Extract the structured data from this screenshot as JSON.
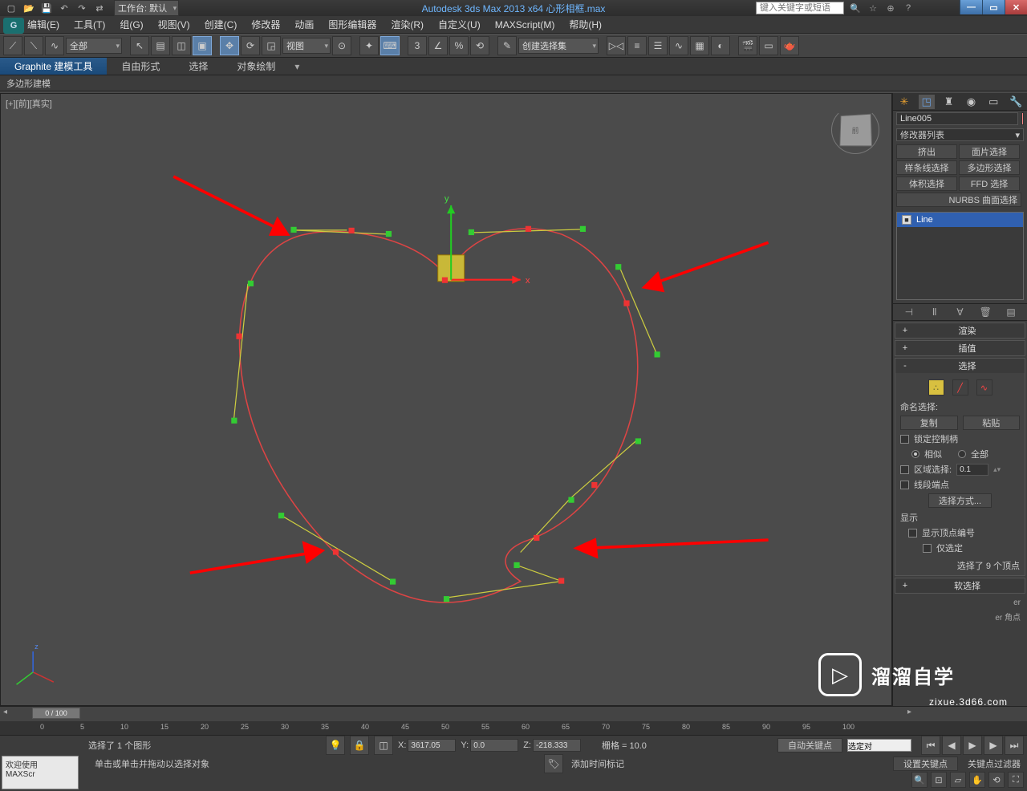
{
  "titlebar": {
    "workspace_label": "工作台: 默认",
    "title": "Autodesk 3ds Max  2013 x64    心形相框.max",
    "search_placeholder": "键入关键字或短语"
  },
  "menu": {
    "items": [
      "编辑(E)",
      "工具(T)",
      "组(G)",
      "视图(V)",
      "创建(C)",
      "修改器",
      "动画",
      "图形编辑器",
      "渲染(R)",
      "自定义(U)",
      "MAXScript(M)",
      "帮助(H)"
    ]
  },
  "toolbar": {
    "sel_filter": "全部",
    "view_dd": "视图",
    "named_set": "创建选择集"
  },
  "ribbon": {
    "tabs": [
      "Graphite 建模工具",
      "自由形式",
      "选择",
      "对象绘制"
    ],
    "sublabel": "多边形建模"
  },
  "viewport": {
    "label": "[+][前][真实]",
    "cube_face": "前",
    "axis": {
      "x": "x",
      "y": "y",
      "z": "z"
    }
  },
  "panel": {
    "obj_name": "Line005",
    "mod_list_label": "修改器列表",
    "quick_buttons": [
      "挤出",
      "面片选择",
      "样条线选择",
      "多边形选择",
      "体积选择",
      "FFD 选择"
    ],
    "nurbs_label": "NURBS 曲面选择",
    "stack_item": "Line",
    "rollouts": {
      "render": "渲染",
      "interp": "插值",
      "select": "选择",
      "soft": "软选择"
    },
    "select_body": {
      "named_label": "命名选择:",
      "copy": "复制",
      "paste": "粘贴",
      "lock_handles": "锁定控制柄",
      "similar": "相似",
      "all": "全部",
      "area_sel": "区域选择:",
      "area_val": "0.1",
      "seg_end": "线段端点",
      "sel_mode": "选择方式...",
      "display": "显示",
      "show_vnum": "显示顶点编号",
      "only_sel": "仅选定",
      "count": "选择了 9 个顶点"
    },
    "ext1": "er",
    "ext2": "er 角点"
  },
  "timeline": {
    "frame_label": "0 / 100",
    "ticks": [
      "0",
      "5",
      "10",
      "15",
      "20",
      "25",
      "30",
      "35",
      "40",
      "45",
      "50",
      "55",
      "60",
      "65",
      "70",
      "75",
      "80",
      "85",
      "90",
      "95",
      "100"
    ]
  },
  "status": {
    "selection": "选择了 1 个图形",
    "prompt": "单击或单击并拖动以选择对象",
    "x_label": "X:",
    "x_val": "3617.05",
    "y_label": "Y:",
    "y_val": "0.0",
    "z_label": "Z:",
    "z_val": "-218.333",
    "grid": "栅格 = 10.0",
    "autokey": "自动关键点",
    "sel_set_dd": "选定对",
    "setkey": "设置关键点",
    "keyfilter": "关键点过滤器",
    "add_marker": "添加时间标记",
    "welcome_line1": "欢迎使用",
    "welcome_line2": "MAXScr"
  },
  "watermark": {
    "text": "溜溜自学",
    "url": "zixue.3d66.com"
  }
}
